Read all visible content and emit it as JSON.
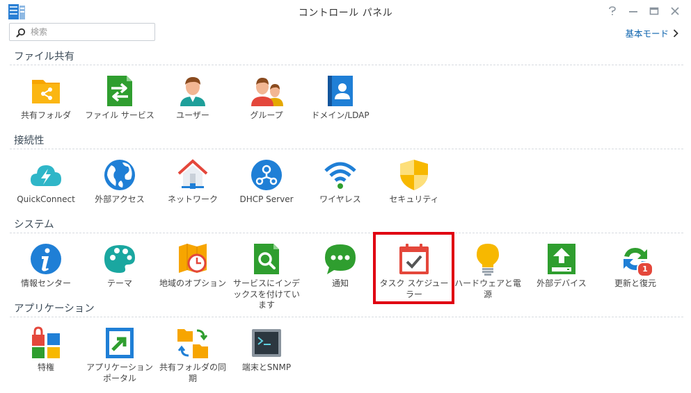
{
  "window": {
    "title": "コントロール パネル",
    "buttons": [
      "help-icon",
      "minimize-icon",
      "maximize-icon",
      "close-icon"
    ]
  },
  "search": {
    "placeholder": "検索",
    "value": ""
  },
  "mode_link": {
    "label": "基本モード",
    "icon": "chevron-right-icon"
  },
  "sections": [
    {
      "title": "ファイル共有",
      "items": [
        {
          "label": "共有フォルダ",
          "icon": "shared-folder-icon"
        },
        {
          "label": "ファイル サービス",
          "icon": "file-services-icon"
        },
        {
          "label": "ユーザー",
          "icon": "user-icon"
        },
        {
          "label": "グループ",
          "icon": "group-icon"
        },
        {
          "label": "ドメイン/LDAP",
          "icon": "domain-ldap-icon"
        }
      ]
    },
    {
      "title": "接続性",
      "items": [
        {
          "label": "QuickConnect",
          "icon": "quickconnect-icon"
        },
        {
          "label": "外部アクセス",
          "icon": "external-access-icon"
        },
        {
          "label": "ネットワーク",
          "icon": "network-icon"
        },
        {
          "label": "DHCP Server",
          "icon": "dhcp-server-icon"
        },
        {
          "label": "ワイヤレス",
          "icon": "wireless-icon"
        },
        {
          "label": "セキュリティ",
          "icon": "security-icon"
        }
      ]
    },
    {
      "title": "システム",
      "items": [
        {
          "label": "情報センター",
          "icon": "info-center-icon"
        },
        {
          "label": "テーマ",
          "icon": "theme-icon"
        },
        {
          "label": "地域のオプション",
          "icon": "regional-options-icon"
        },
        {
          "label": "サービスにインデックスを付けています",
          "icon": "indexing-service-icon"
        },
        {
          "label": "通知",
          "icon": "notification-icon"
        },
        {
          "label": "タスク スケジューラー",
          "icon": "task-scheduler-icon"
        },
        {
          "label": "ハードウェアと電源",
          "icon": "hardware-power-icon"
        },
        {
          "label": "外部デバイス",
          "icon": "external-devices-icon"
        },
        {
          "label": "更新と復元",
          "icon": "update-restore-icon",
          "badge": "1"
        }
      ]
    },
    {
      "title": "アプリケーション",
      "items": [
        {
          "label": "特権",
          "icon": "privileges-icon"
        },
        {
          "label": "アプリケーション ポータル",
          "icon": "application-portal-icon"
        },
        {
          "label": "共有フォルダの同期",
          "icon": "shared-folder-sync-icon"
        },
        {
          "label": "端末とSNMP",
          "icon": "terminal-snmp-icon"
        }
      ]
    }
  ],
  "colors": {
    "accent_link": "#0a62ad",
    "highlight_box": "#e00012",
    "folder_orange": "#f7a500",
    "green": "#2f9e2f",
    "blue": "#1f7fd6"
  }
}
